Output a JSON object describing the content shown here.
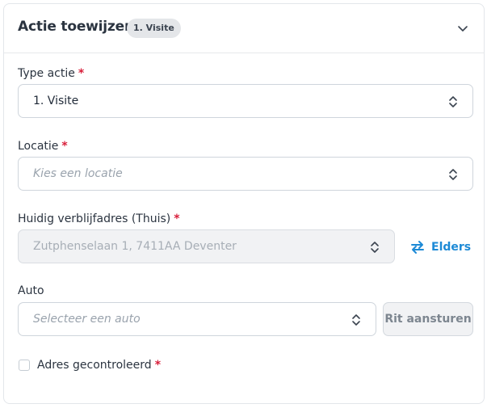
{
  "header": {
    "title": "Actie toewijzen",
    "badge": "1. Visite",
    "collapse_icon": "chevron-down-icon"
  },
  "form": {
    "type_actie": {
      "label": "Type actie",
      "required": "*",
      "value": "1. Visite"
    },
    "locatie": {
      "label": "Locatie",
      "required": "*",
      "placeholder": "Kies een locatie"
    },
    "verblijfadres": {
      "label": "Huidig verblijfadres (Thuis)",
      "required": "*",
      "value": "Zutphenselaan 1, 7411AA Deventer",
      "alt_link": "Elders"
    },
    "auto": {
      "label": "Auto",
      "placeholder": "Selecteer een auto",
      "button": "Rit aansturen"
    },
    "adres_check": {
      "label": "Adres gecontroleerd",
      "required": "*",
      "checked": false
    }
  },
  "colors": {
    "required": "#d81e3a",
    "link": "#1d8ad6",
    "border": "#cfd5dc"
  }
}
